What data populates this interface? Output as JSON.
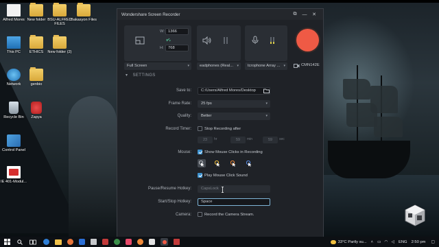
{
  "desktop": {
    "icons": [
      {
        "label": "Alfred Mores",
        "type": "doc"
      },
      {
        "label": "New folder",
        "type": "folder"
      },
      {
        "label": "BSU-ALFRED FILES",
        "type": "folder"
      },
      {
        "label": "Bakasyon Files",
        "type": "folder"
      },
      {
        "label": "This PC",
        "type": "pc"
      },
      {
        "label": "ETHICS",
        "type": "folder"
      },
      {
        "label": "New folder (2)",
        "type": "folder"
      },
      {
        "label": "Network",
        "type": "network"
      },
      {
        "label": "genbio",
        "type": "folder"
      },
      {
        "label": "Recycle Bin",
        "type": "recycle-bin"
      },
      {
        "label": "Zapya",
        "type": "app"
      },
      {
        "label": "Control Panel",
        "type": "control-panel"
      },
      {
        "label": "IE 401-Modul...",
        "type": "pdf"
      }
    ]
  },
  "recorder": {
    "title": "Wondershare Screen Recorder",
    "width_label": "W:",
    "width_value": "1366",
    "height_label": "H:",
    "height_value": "768",
    "screen_mode": "Full Screen",
    "audio_device": "eadphones (Real...",
    "mic_device": "tcrophone Array ...",
    "webcam_label": "CMN142E",
    "settings_heading": "SETTINGS",
    "save_to_label": "Save to:",
    "save_to_value": "C:/Users/Alfred Mores/Desktop",
    "frame_rate_label": "Frame Rate:",
    "frame_rate_value": "25 fps",
    "quality_label": "Quality:",
    "quality_value": "Better",
    "record_timer_label": "Record Timer:",
    "stop_recording_after": "Stop Recording after",
    "timer_hours": "23",
    "timer_hours_unit": "hr",
    "timer_minutes": "59",
    "timer_minutes_unit": "min",
    "timer_seconds": "59",
    "timer_seconds_unit": "sec",
    "mouse_label": "Mouse:",
    "show_mouse_clicks": "Show Mouse Clicks in Recording",
    "play_mouse_click_sound": "Play Mouse Click Sound",
    "pause_hotkey_label": "Pause/Resume Hotkey:",
    "pause_hotkey_value": "CapsLock",
    "start_stop_hotkey_label": "Start/Stop Hotkey:",
    "start_stop_hotkey_value": "Space",
    "camera_label": "Camera:",
    "record_camera_stream": "Record the Camera Stream.",
    "record_timer_checked": false,
    "show_mouse_clicks_checked": true,
    "play_click_sound_checked": true,
    "camera_checked": false
  },
  "taskbar": {
    "weather": "33°C  Partly su...",
    "language": "ENG",
    "time": "2:50 pm"
  },
  "colors": {
    "record_button": "#ef5a45",
    "accent": "#3f93cf",
    "window_bg": "#1f2227"
  }
}
